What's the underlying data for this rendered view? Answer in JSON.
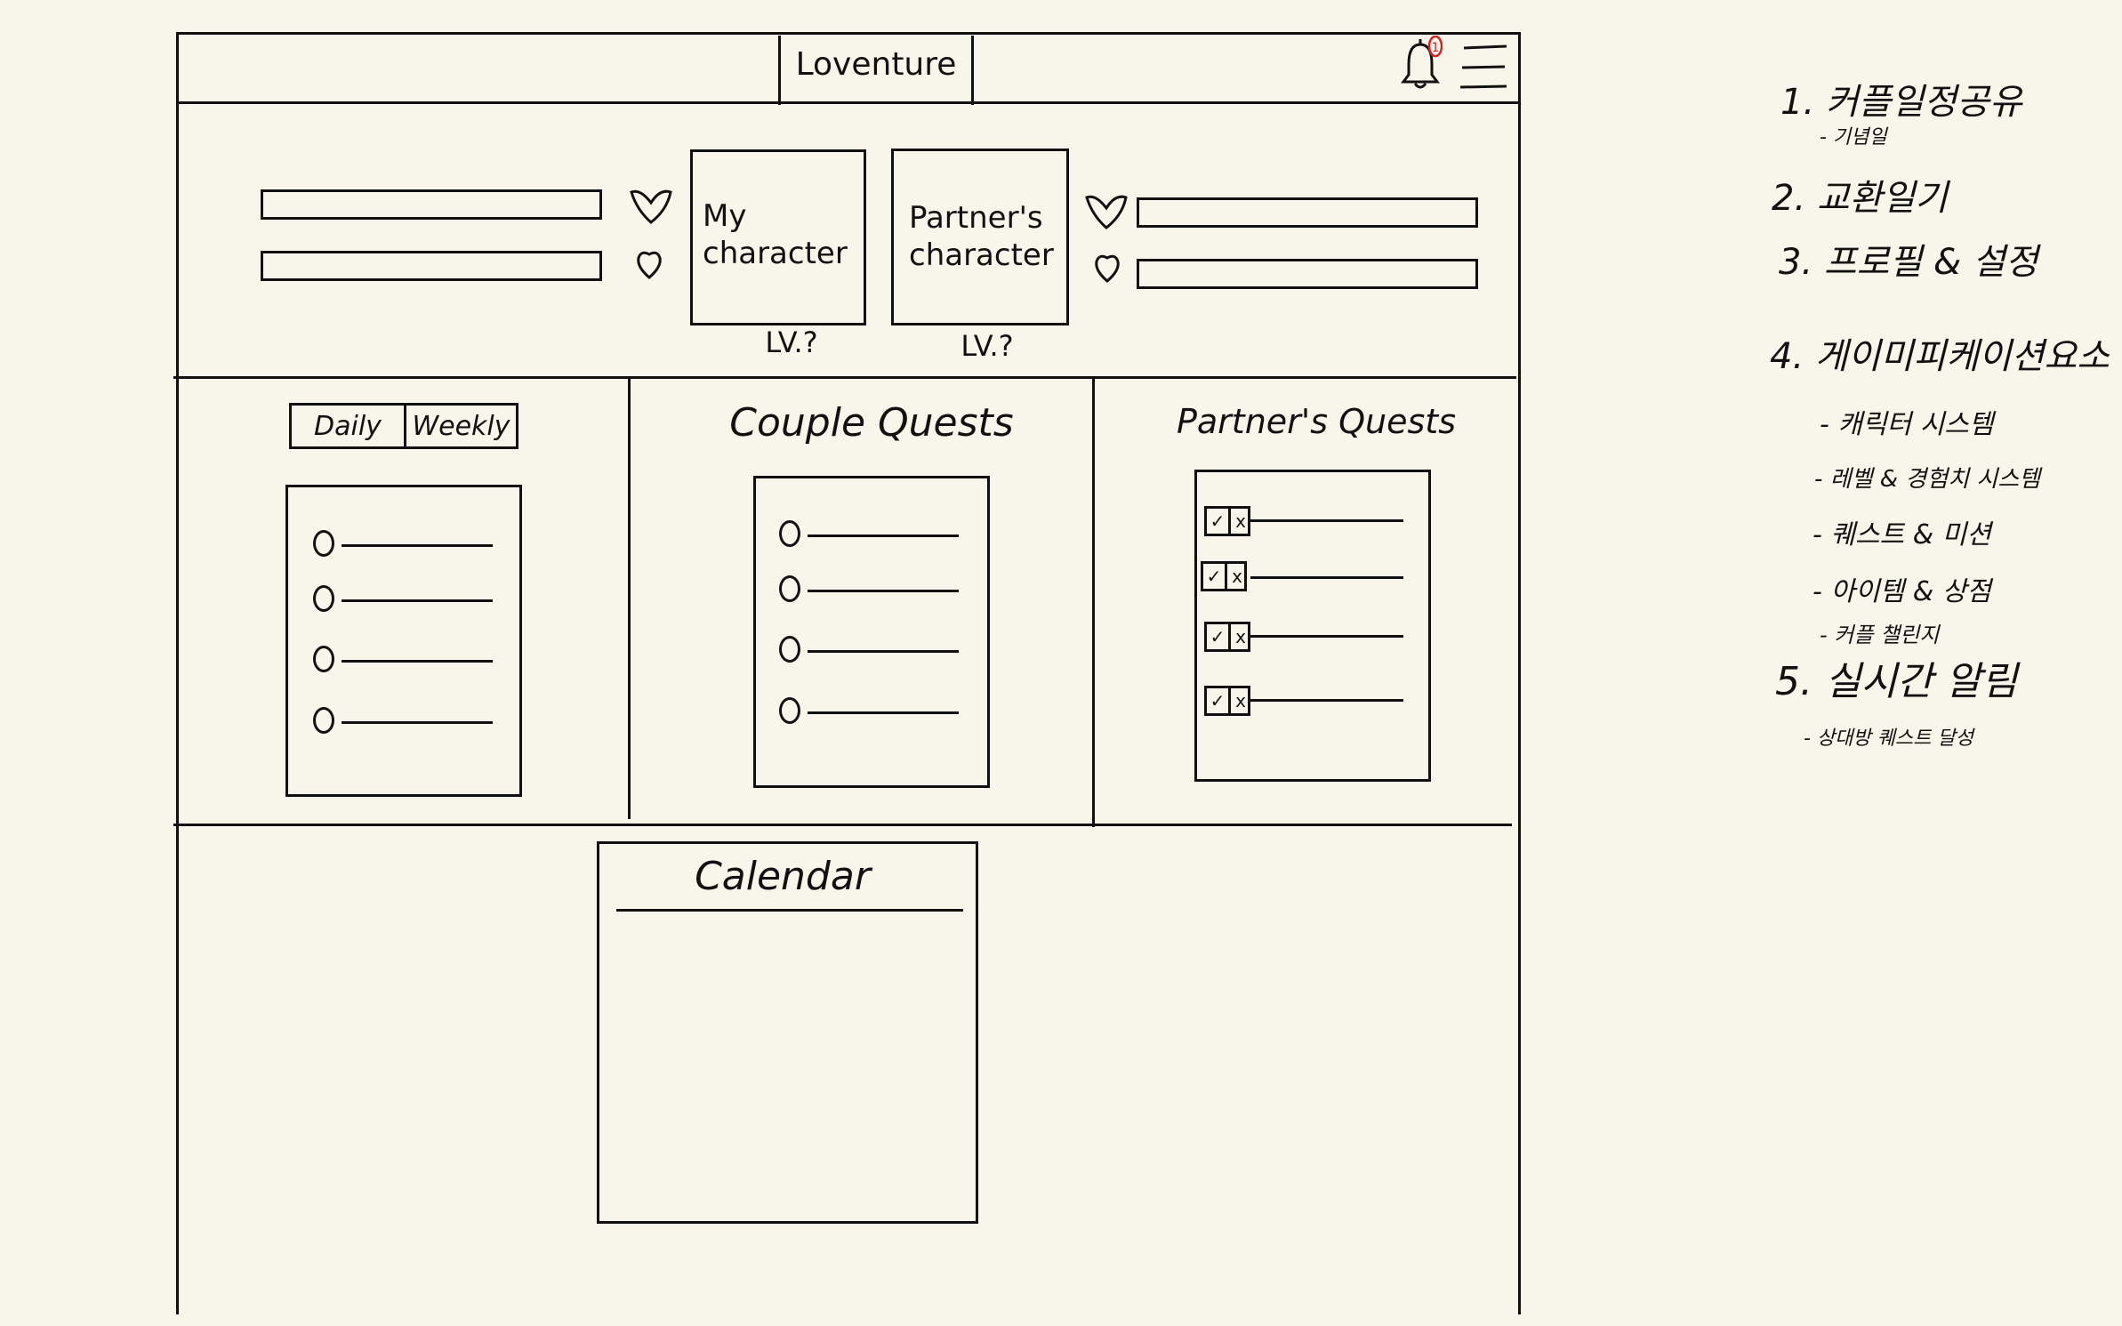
{
  "app": {
    "title": "Loventure",
    "notification_count": "1"
  },
  "characters": {
    "my_label_line1": "My",
    "my_label_line2": "character",
    "partner_label_line1": "Partner's",
    "partner_label_line2": "character",
    "my_level": "LV.?",
    "partner_level": "LV.?"
  },
  "quests": {
    "tabs": [
      "Daily",
      "Weekly"
    ],
    "couple_title": "Couple Quests",
    "partner_title": "Partner's Quests",
    "partner_check_marks": [
      "✓",
      "x"
    ]
  },
  "calendar": {
    "title": "Calendar"
  },
  "notes": [
    {
      "text": "1. 커플일정공유",
      "size": "main"
    },
    {
      "text": "- 기념일",
      "size": "sub"
    },
    {
      "text": "2. 교환일기",
      "size": "main"
    },
    {
      "text": "3. 프로필 & 설정",
      "size": "main"
    },
    {
      "text": "4. 게이미피케이션요소",
      "size": "main"
    },
    {
      "text": "- 캐릭터 시스템",
      "size": "sub"
    },
    {
      "text": "- 레벨 & 경험치 시스템",
      "size": "sub"
    },
    {
      "text": "- 퀘스트 & 미션",
      "size": "sub"
    },
    {
      "text": "- 아이템 & 상점",
      "size": "sub"
    },
    {
      "text": "- 커플 챌린지",
      "size": "sub"
    },
    {
      "text": "5. 실시간 알림",
      "size": "main"
    },
    {
      "text": "- 상대방 퀘스트 달성",
      "size": "sub"
    }
  ],
  "colors": {
    "background": "#f8f6ea",
    "ink": "#111111",
    "badge": "#d22222"
  }
}
